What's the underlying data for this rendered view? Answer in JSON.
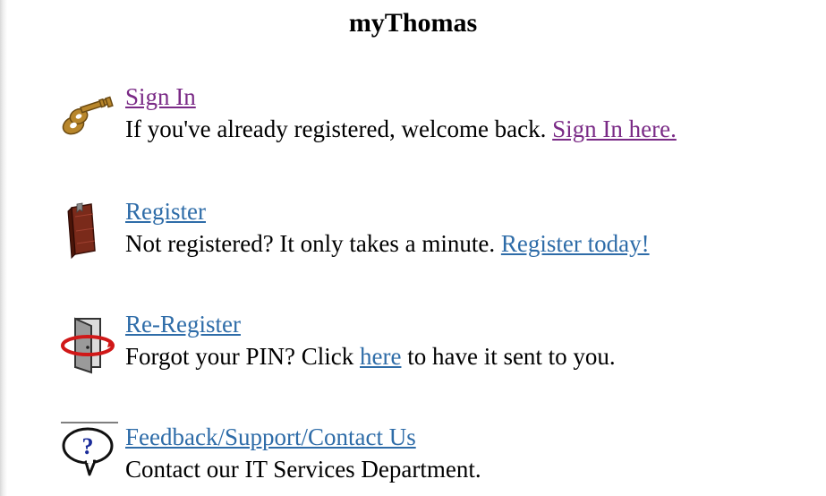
{
  "page": {
    "title": "myThomas"
  },
  "entries": [
    {
      "icon": "key-icon",
      "heading": "Sign In",
      "desc_before": "If you've already registered, welcome back. ",
      "desc_link": "Sign In here.",
      "desc_after": ""
    },
    {
      "icon": "book-icon",
      "heading": "Register",
      "desc_before": "Not registered? It only takes a minute. ",
      "desc_link": "Register today!",
      "desc_after": ""
    },
    {
      "icon": "door-refresh-icon",
      "heading": "Re-Register",
      "desc_before": "Forgot your PIN? Click ",
      "desc_link": "here",
      "desc_after": " to have it sent to you."
    },
    {
      "icon": "help-bubble-icon",
      "heading": "Feedback/Support/Contact Us",
      "desc_before": "Contact our IT Services Department.",
      "desc_link": "",
      "desc_after": ""
    }
  ],
  "colors": {
    "visited_link": "#7a2a86",
    "link": "#2e6ca8",
    "text": "#000000"
  }
}
